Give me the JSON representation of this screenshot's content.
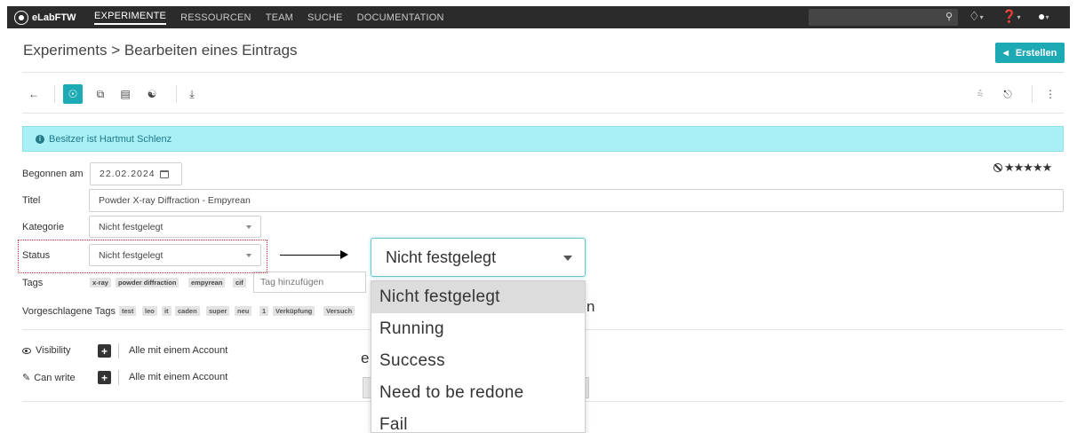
{
  "navbar": {
    "brand": "eLabFTW",
    "items": [
      "EXPERIMENTE",
      "RESSOURCEN",
      "TEAM",
      "SUCHE",
      "DOCUMENTATION"
    ],
    "active_item": "EXPERIMENTE",
    "icons": [
      "search-icon",
      "bell-icon",
      "help-icon",
      "user-icon"
    ]
  },
  "header": {
    "title": "Experiments > Bearbeiten eines Eintrags",
    "create_label": "Erstellen"
  },
  "toolbar": {
    "left_icons": [
      "back-arrow-icon",
      "view-icon",
      "duplicate-icon",
      "timestamp-icon",
      "share-icon",
      "download-icon"
    ],
    "right_icons": [
      "pin-icon",
      "lock-icon",
      "more-icon"
    ]
  },
  "alert": {
    "text": "Besitzer ist Hartmut Schlenz"
  },
  "form": {
    "date_label": "Begonnen am",
    "date_value": "22.02.2024",
    "title_label": "Titel",
    "title_value": "Powder X-ray Diffraction - Empyrean",
    "category_label": "Kategorie",
    "category_value": "Nicht festgelegt",
    "status_label": "Status",
    "status_value": "Nicht festgelegt",
    "tags_label": "Tags",
    "tags": [
      "x-ray",
      "powder diffraction",
      "empyrean",
      "cif"
    ],
    "tag_placeholder": "Tag hinzufügen",
    "suggested_label": "Vorgeschlagene Tags",
    "suggested_tags": [
      "test",
      "leo",
      "it",
      "caden",
      "super",
      "neu",
      "1",
      "Verküpfung",
      "Versuch"
    ],
    "rating_stars": 5
  },
  "permissions": {
    "visibility_label": "Visibility",
    "visibility_value": "Alle mit einem Account",
    "canwrite_label": "Can write",
    "canwrite_value": "Alle mit einem Account"
  },
  "status_dropdown": {
    "selected": "Nicht festgelegt",
    "options": [
      "Nicht festgelegt",
      "Running",
      "Success",
      "Need to be redone",
      "Fail"
    ]
  }
}
